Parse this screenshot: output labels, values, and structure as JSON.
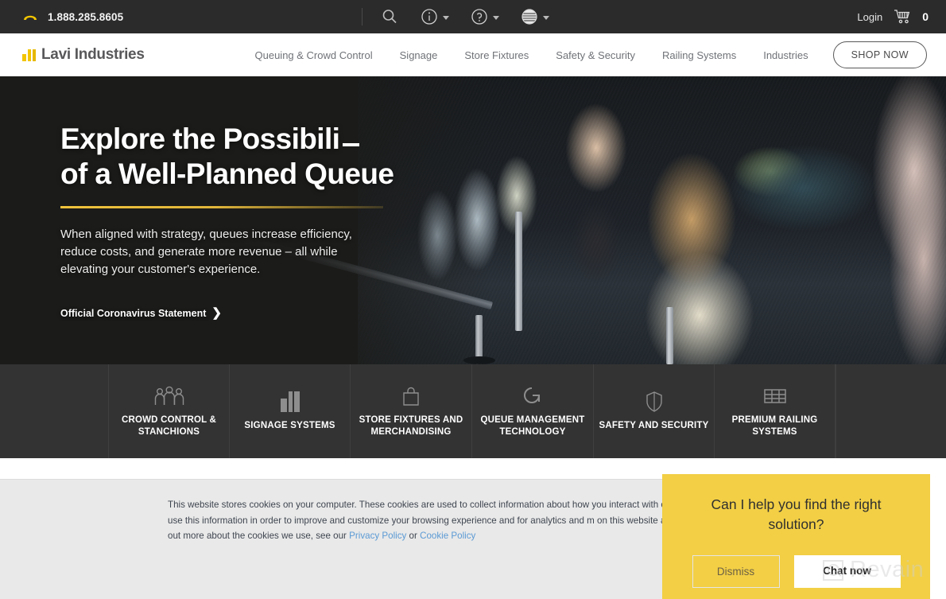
{
  "topbar": {
    "phone": "1.888.285.8605",
    "phone_icon": "phone-icon",
    "search_icon": "search-icon",
    "info_icon": "info-circle-icon",
    "help_icon": "question-circle-icon",
    "language_icon": "globe-flag-icon",
    "login_label": "Login",
    "cart_icon": "shopping-cart-icon",
    "cart_count": "0",
    "background": "#2b2b2b"
  },
  "header": {
    "logo_text": "Lavi Industries",
    "logo_mark": "lavi-bars-logo",
    "accent": "#f2c500",
    "nav": [
      {
        "label": "Queuing & Crowd Control"
      },
      {
        "label": "Signage"
      },
      {
        "label": "Store Fixtures"
      },
      {
        "label": "Safety & Security"
      },
      {
        "label": "Railing Systems"
      },
      {
        "label": "Industries"
      }
    ],
    "shop_now_label": "SHOP NOW"
  },
  "hero": {
    "headline_line1": "Explore the Possibili",
    "headline_line2": "of a Well-Planned Queue",
    "subhead": "When aligned with strategy, queues increase efficiency, reduce costs, and generate more revenue – all while elevating your customer's experience.",
    "link_label": "Official Coronavirus Statement",
    "link_arrow": "❯",
    "rule_color": "#e0b53a",
    "background": "#1b1b19"
  },
  "tiles": {
    "background": "#333333",
    "items": [
      {
        "label": "CROWD CONTROL & STANCHIONS",
        "icon": "people-group-icon"
      },
      {
        "label": "SIGNAGE SYSTEMS",
        "icon": "signage-bars-icon"
      },
      {
        "label": "STORE FIXTURES AND MERCHANDISING",
        "icon": "shopping-bag-icon"
      },
      {
        "label": "QUEUE MANAGEMENT TECHNOLOGY",
        "icon": "queue-q-icon"
      },
      {
        "label": "SAFETY AND SECURITY",
        "icon": "shield-icon"
      },
      {
        "label": "PREMIUM RAILING SYSTEMS",
        "icon": "railing-grid-icon"
      }
    ]
  },
  "cookie": {
    "text_part1": "This website stores cookies on your computer. These cookies are used to collect information about how you interact with our",
    "text_part2": "remember you. We use this information in order to improve and customize your browsing experience and for analytics and m",
    "text_part3": "on this website and other media. To find out more about the cookies we use, see our ",
    "privacy_link": "Privacy Policy",
    "or_text": " or ",
    "cookie_link": "Cookie Policy",
    "link_color": "#5b9ad4",
    "background": "#e9e9e9"
  },
  "chat": {
    "title": "Can I help you find the right solution?",
    "dismiss_label": "Dismiss",
    "chat_now_label": "Chat now",
    "background": "#f2cf45"
  },
  "watermark": {
    "text": "Revain",
    "icon": "revain-magnifier-icon"
  }
}
